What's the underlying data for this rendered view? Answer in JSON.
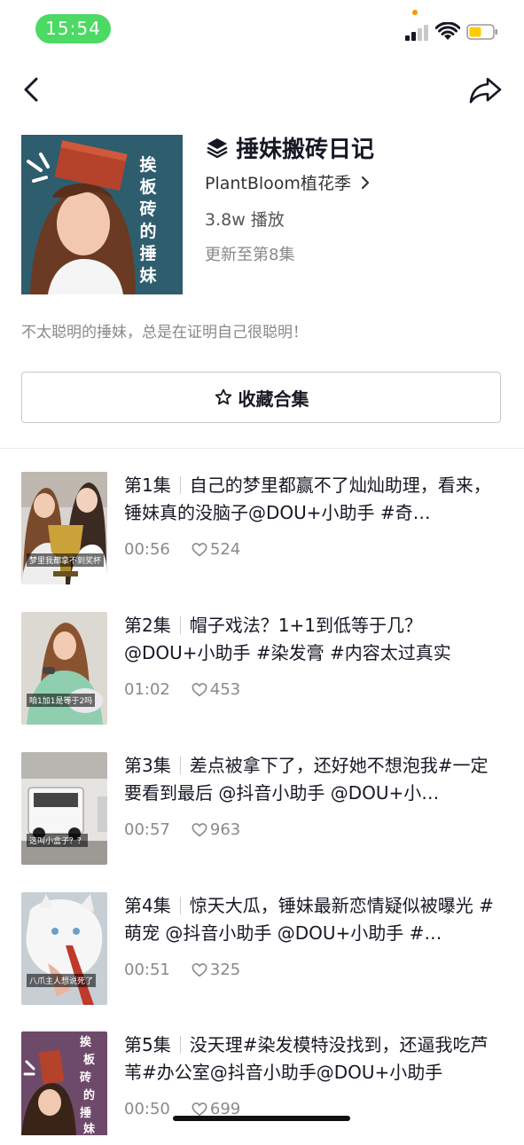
{
  "status": {
    "time": "15:54"
  },
  "collection": {
    "title": "捶妹搬砖日记",
    "author": "PlantBloom植花季",
    "plays": "3.8w 播放",
    "updated": "更新至第8集",
    "description": "不太聪明的捶妹，总是在证明自己很聪明！",
    "favorite_label": "收藏合集",
    "cover_text": [
      "挨",
      "板",
      "砖",
      "的",
      "捶",
      "妹"
    ]
  },
  "episodes": [
    {
      "label": "第1集",
      "text": "自己的梦里都赢不了灿灿助理，看来，锤妹真的没脑子@DOU+小助手 #奇…",
      "duration": "00:56",
      "likes": "524",
      "caption": "梦里我都拿不到奖杯"
    },
    {
      "label": "第2集",
      "text": "帽子戏法？1+1到低等于几？@DOU+小助手 #染发膏 #内容太过真实",
      "duration": "01:02",
      "likes": "453",
      "caption": "咱1加1是等于2吗"
    },
    {
      "label": "第3集",
      "text": "差点被拿下了，还好她不想泡我#一定要看到最后 @抖音小助手 @DOU+小…",
      "duration": "00:57",
      "likes": "963",
      "caption": "这叫小盒子？？"
    },
    {
      "label": "第4集",
      "text": "惊天大瓜，锤妹最新恋情疑似被曝光 #萌宠 @抖音小助手 @DOU+小助手 #…",
      "duration": "00:51",
      "likes": "325",
      "caption": "八爪主人想说死了"
    },
    {
      "label": "第5集",
      "text": "没天理#染发模特没找到，还逼我吃芦苇#办公室@抖音小助手@DOU+小助手",
      "duration": "00:50",
      "likes": "699",
      "caption": ""
    }
  ],
  "icons": [
    "back-icon",
    "share-icon",
    "layers-icon",
    "chevron-right-icon",
    "star-icon",
    "heart-icon",
    "signal-icon",
    "wifi-icon",
    "battery-icon"
  ],
  "colors": {
    "status_pill": "#4cd964",
    "battery": "#ffcc00",
    "text": "#161823",
    "muted": "#8a8a8a"
  }
}
